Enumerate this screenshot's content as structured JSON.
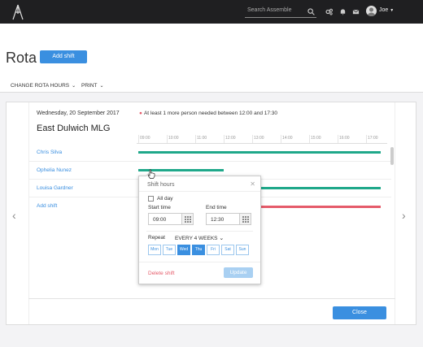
{
  "topbar": {
    "search_placeholder": "Search Assemble",
    "user_name": "Joe",
    "icons": [
      "logo-icon",
      "search-icon",
      "gears-icon",
      "bell-icon",
      "mail-icon",
      "avatar",
      "chevron-down-icon"
    ]
  },
  "page": {
    "title": "Rota",
    "add_shift_label": "Add shift"
  },
  "subnav": {
    "change_rota_hours": "CHANGE ROTA HOURS",
    "print": "PRINT"
  },
  "schedule": {
    "date": "Wednesday, 20 September 2017",
    "notice": "At least 1 more person needed between 12:00 and 17:30",
    "location": "East Dulwich MLG",
    "hours": [
      "09:00",
      "10:00",
      "11:00",
      "12:00",
      "13:00",
      "14:00",
      "15:00",
      "16:00",
      "17:00"
    ],
    "staff": [
      {
        "name": "Chris Silva",
        "start": "09:00",
        "end": "17:30"
      },
      {
        "name": "Ophelia Nunez",
        "start": "09:00",
        "end": "12:00"
      },
      {
        "name": "Louisa Gardner",
        "start": "12:00",
        "end": "17:30"
      }
    ],
    "add_shift_link": "Add shift",
    "needed_gap": {
      "start": "12:00",
      "end": "17:30"
    },
    "close_label": "Close"
  },
  "popup": {
    "title": "Shift hours",
    "all_day_label": "All day",
    "all_day_checked": false,
    "start_label": "Start time",
    "start_value": "09:00",
    "end_label": "End time",
    "end_value": "12:30",
    "repeat_label": "Repeat",
    "repeat_value": "EVERY 4 WEEKS",
    "days": [
      {
        "label": "Mon",
        "on": false
      },
      {
        "label": "Tue",
        "on": false
      },
      {
        "label": "Wed",
        "on": true
      },
      {
        "label": "Thu",
        "on": true
      },
      {
        "label": "Fri",
        "on": false
      },
      {
        "label": "Sat",
        "on": false
      },
      {
        "label": "Sun",
        "on": false
      }
    ],
    "delete_label": "Delete shift",
    "update_label": "Update"
  },
  "colors": {
    "accent": "#3a8fe0",
    "shift_bar": "#1fa88a",
    "needed_bar": "#e55b6a",
    "topbar": "#1f1f21"
  }
}
